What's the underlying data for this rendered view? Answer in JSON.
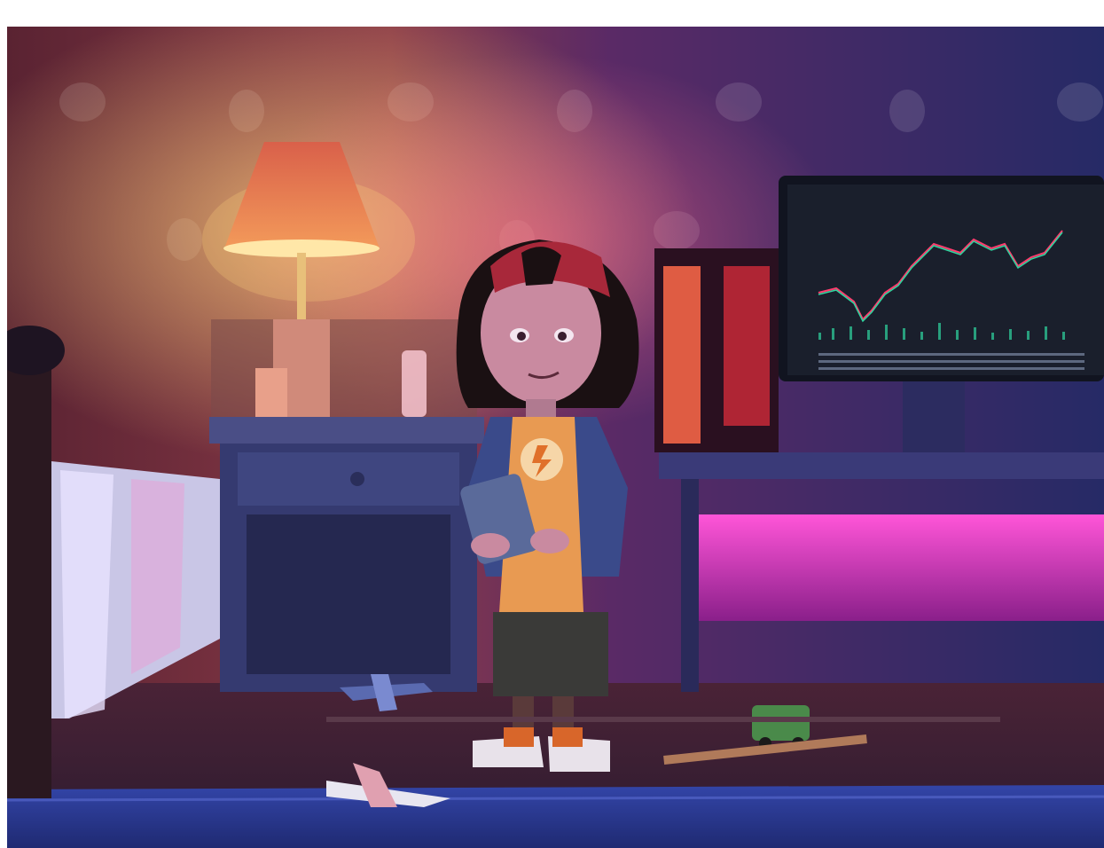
{
  "scene": {
    "kind": "3d-rendered-illustration",
    "elements": [
      "bedroom-wall",
      "table-lamp",
      "nightstand",
      "bed",
      "gaming-pc",
      "monitor",
      "led-strip",
      "child",
      "handheld-console",
      "toy-plane",
      "toy-jet",
      "toy-car",
      "rug"
    ],
    "monitor": {
      "chart_type": "candlestick",
      "up_color": "#2fd6a0",
      "down_color": "#ff3d6e"
    },
    "colors": {
      "wall_left": "#6a2a3a",
      "wall_right": "#2a2e6a",
      "lamp_glow": "#ffd27a",
      "led_strip": "#ff3cc8",
      "pc_glow": "#ff3a3a",
      "floor": "#3b1f2e",
      "rug": "#2f3fa0"
    }
  }
}
